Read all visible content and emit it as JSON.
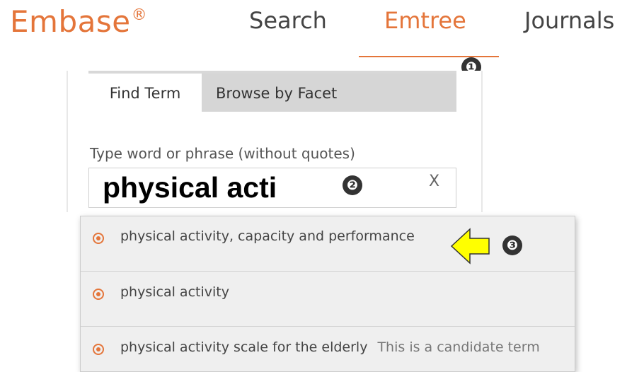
{
  "header": {
    "logo": "Embase",
    "logo_mark": "®",
    "nav": [
      "Search",
      "Emtree",
      "Journals"
    ],
    "active_nav": "Emtree",
    "accent_color": "#e4753a"
  },
  "markers": [
    "❶",
    "❷",
    "❸"
  ],
  "panel": {
    "tabs": [
      "Find Term",
      "Browse by Facet"
    ],
    "active_tab": "Find Term",
    "field_label": "Type word or phrase (without quotes)",
    "search_value": "physical acti",
    "clear_label": "X"
  },
  "suggestions": [
    {
      "label": "physical activity, capacity and performance",
      "note": ""
    },
    {
      "label": "physical activity",
      "note": ""
    },
    {
      "label": "physical activity scale for the elderly",
      "note": "This is a candidate term"
    }
  ],
  "icons": {
    "pointer": "left-arrow-icon",
    "pointer_color": "#ffff00"
  }
}
